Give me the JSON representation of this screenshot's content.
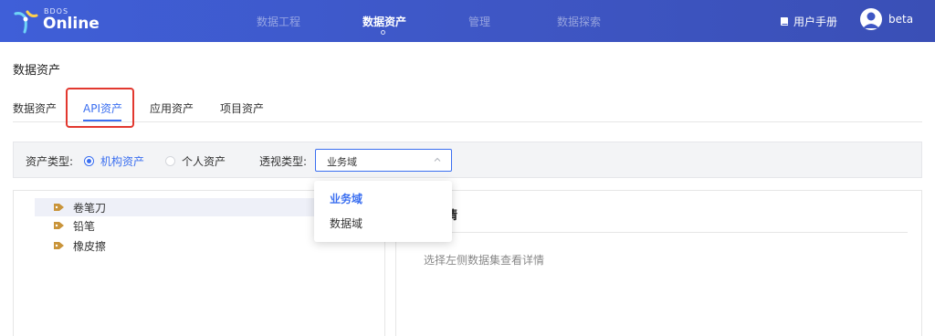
{
  "brand": {
    "small": "BDOS",
    "big": "Online"
  },
  "nav": {
    "items": [
      {
        "label": "数据工程"
      },
      {
        "label": "数据资产"
      },
      {
        "label": "管理"
      },
      {
        "label": "数据探索"
      }
    ],
    "active_index": 1,
    "manual_label": "用户手册",
    "user_name": "beta"
  },
  "page": {
    "title": "数据资产"
  },
  "tabs": [
    {
      "label": "数据资产"
    },
    {
      "label": "API资产"
    },
    {
      "label": "应用资产"
    },
    {
      "label": "项目资产"
    }
  ],
  "active_tab_index": 1,
  "filters": {
    "asset_type_label": "资产类型:",
    "options": [
      {
        "label": "机构资产",
        "checked": true
      },
      {
        "label": "个人资产",
        "checked": false
      }
    ],
    "perspective_label": "透视类型:",
    "perspective_value": "业务域"
  },
  "dropdown": {
    "options": [
      {
        "label": "业务域",
        "active": true
      },
      {
        "label": "数据域",
        "active": false
      }
    ]
  },
  "tree": {
    "items": [
      {
        "label": "卷笔刀",
        "icon": "tag-icon",
        "selected": true
      },
      {
        "label": "铅笔",
        "icon": "tag-icon",
        "selected": false
      },
      {
        "label": "橡皮擦",
        "icon": "tag-icon",
        "selected": false
      }
    ]
  },
  "detail": {
    "title": "集详情",
    "hint": "选择左侧数据集查看详情"
  },
  "colors": {
    "header_bg": "#3e56c4",
    "accent": "#3b6ff0",
    "highlight_box": "#e2382f",
    "tag_icon": "#c9943a"
  }
}
